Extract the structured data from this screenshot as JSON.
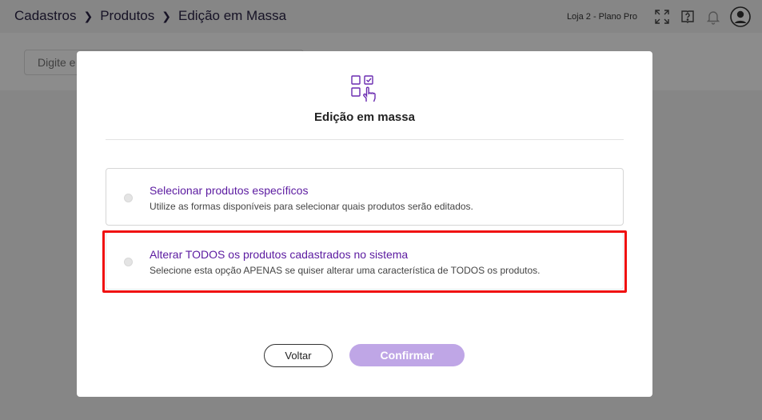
{
  "header": {
    "breadcrumbs": [
      "Cadastros",
      "Produtos",
      "Edição em Massa"
    ],
    "store_label": "Loja 2 - Plano Pro",
    "icons": [
      "fullscreen-icon",
      "help-book-icon",
      "bell-icon",
      "user-avatar-icon"
    ]
  },
  "toolbar": {
    "search_placeholder": "Digite e"
  },
  "modal": {
    "icon": "checklist-pointer-icon",
    "title": "Edição em massa",
    "options": [
      {
        "title": "Selecionar produtos específicos",
        "description": "Utilize as formas disponíveis para selecionar quais produtos serão editados.",
        "selected": false
      },
      {
        "title": "Alterar TODOS os produtos cadastrados no sistema",
        "description": "Selecione esta opção APENAS se quiser alterar uma característica de TODOS os produtos.",
        "selected": false
      }
    ],
    "back_label": "Voltar",
    "confirm_label": "Confirmar"
  },
  "colors": {
    "accent": "#5b1aa0",
    "confirm_disabled": "#bfa6e6",
    "highlight": "#f01010"
  }
}
